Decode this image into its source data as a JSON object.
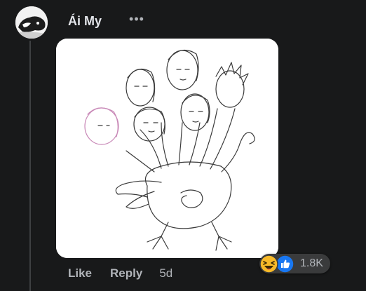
{
  "comment": {
    "author": "Ái My",
    "more_label": "•••",
    "actions": {
      "like_label": "Like",
      "reply_label": "Reply",
      "timestamp": "5d"
    },
    "reactions": {
      "icons": [
        "haha-icon",
        "like-icon"
      ],
      "count": "1.8K"
    }
  },
  "colors": {
    "background": "#18191a",
    "text_primary": "#e4e6eb",
    "text_secondary": "#b0b3b8",
    "reaction_pill": "#3a3b3c",
    "like_blue": "#1877f2",
    "haha_yellow": "#f7b928"
  }
}
